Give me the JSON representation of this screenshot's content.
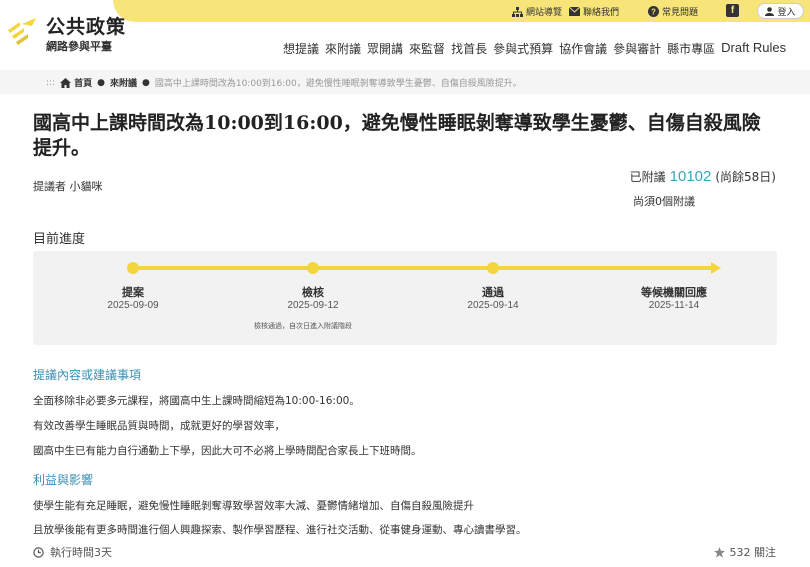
{
  "brand": {
    "title": "公共政策",
    "subtitle": "網路參與平臺",
    "accent": "#f7e57a",
    "progress_color": "#f3d63f",
    "link_color": "#3a8fb5",
    "count_color": "#3aa6b9"
  },
  "utility": {
    "sitemap": "網站導覽",
    "contact": "聯絡我們",
    "faq": "常見問題",
    "facebook": "f",
    "login": "登入"
  },
  "nav": [
    "想提議",
    "來附議",
    "眾開講",
    "來監督",
    "找首長",
    "參與式預算",
    "協作會議",
    "參與審計",
    "縣市專區",
    "Draft Rules"
  ],
  "breadcrumb": {
    "prefix": ":::",
    "home": "首頁",
    "section": "來附議",
    "current": "國高中上課時間改為10:00到16:00，避免慢性睡眠剝奪導致學生憂鬱、自傷自殺風險提升。"
  },
  "proposal": {
    "title": "國高中上課時間改為10:00到16:00，避免慢性睡眠剝奪導致學生憂鬱、自傷自殺風險提升。",
    "proposer": "提議者 小貓咪",
    "signed_label": "已附議",
    "signed_count": "10102",
    "remaining": "(尚餘58日)",
    "need": "尚須0個附議"
  },
  "progress": {
    "label": "目前進度",
    "steps": [
      {
        "name": "提案",
        "date": "2025-09-09"
      },
      {
        "name": "檢核",
        "date": "2025-09-12"
      },
      {
        "name": "通過",
        "date": "2025-09-14"
      },
      {
        "name": "等候機關回應",
        "date": "2025-11-14"
      }
    ],
    "note": "檢核通過，自次日進入附議階段"
  },
  "content": {
    "title": "提議內容或建議事項",
    "lines": [
      "全面移除非必要多元課程，將國高中生上課時間縮短為10:00-16:00。",
      "有效改善學生睡眠品質與時間，成就更好的學習效率，",
      "國高中生已有能力自行通勤上下學，因此大可不必將上學時間配合家長上下班時間。"
    ]
  },
  "benefit": {
    "title": "利益與影響",
    "lines": [
      "使學生能有充足睡眠，避免慢性睡眠剝奪導致學習效率大減、憂鬱情緒增加、自傷自殺風險提升",
      "且放學後能有更多時間進行個人興趣探索、製作學習歷程、進行社交活動、從事健身運動、專心讀書學習。"
    ]
  },
  "footer": {
    "duration": "執行時間3天",
    "follow": "532 關注"
  }
}
